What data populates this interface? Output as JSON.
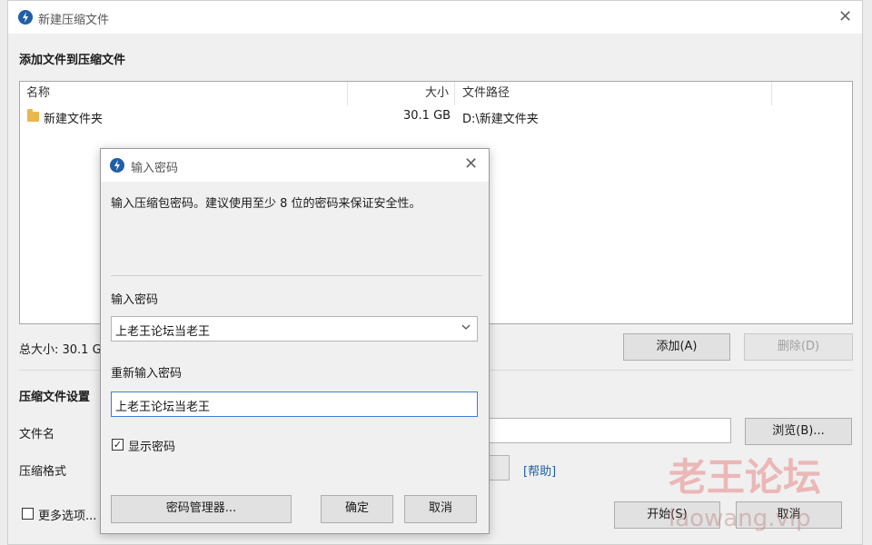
{
  "window": {
    "title": "新建压缩文件",
    "close_symbol": "✕"
  },
  "section_add": {
    "heading": "添加文件到压缩文件"
  },
  "file_table": {
    "columns": {
      "name": "名称",
      "size": "大小",
      "path": "文件路径"
    },
    "rows": [
      {
        "name": "新建文件夹",
        "size": "30.1 GB",
        "path": "D:\\新建文件夹"
      }
    ]
  },
  "total_size": "总大小: 30.1 G",
  "buttons": {
    "add": "添加(A)",
    "delete": "删除(D)",
    "browse": "浏览(B)...",
    "start": "开始(S)",
    "cancel": "取消"
  },
  "settings": {
    "heading": "压缩文件设置",
    "filename_label": "文件名",
    "format_label": "压缩格式",
    "help_link": "[帮助]"
  },
  "more_options": {
    "label": "更多选项...",
    "checked": false
  },
  "password_dialog": {
    "title": "输入密码",
    "close_symbol": "✕",
    "hint": "输入压缩包密码。建议使用至少 8 位的密码来保证安全性。",
    "password_label": "输入密码",
    "password_value": "上老王论坛当老王",
    "reenter_label": "重新输入密码",
    "reenter_value": "上老王论坛当老王",
    "show_password": {
      "label": "显示密码",
      "checked": true,
      "check_mark": "✓"
    },
    "buttons": {
      "manager": "密码管理器...",
      "ok": "确定",
      "cancel": "取消"
    }
  },
  "watermark": {
    "text": "老王论坛",
    "url": "laowang.vip"
  },
  "icons": {
    "app": "app-logo-icon",
    "folder": "folder-icon",
    "dropdown": "chevron-down-icon"
  },
  "colors": {
    "accent": "#1f5fa8",
    "folder": "#e9b84d",
    "watermark": "#e15a5a"
  }
}
